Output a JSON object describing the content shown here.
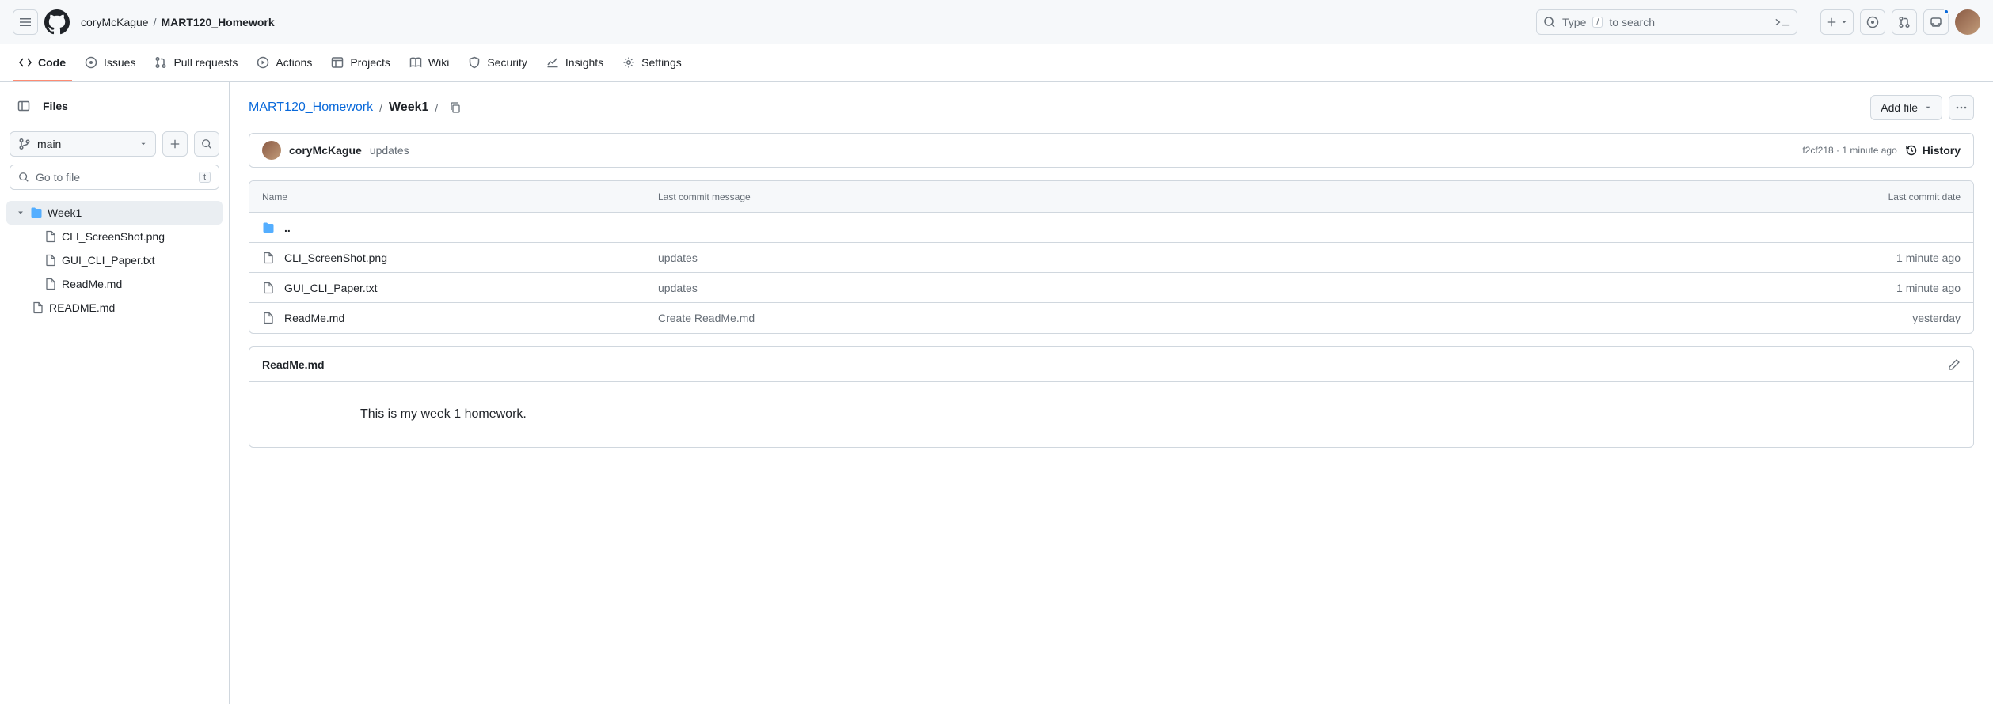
{
  "header": {
    "owner": "coryMcKague",
    "repo": "MART120_Homework",
    "search_prefix": "Type ",
    "search_key": "/",
    "search_suffix": " to search"
  },
  "nav": {
    "code": "Code",
    "issues": "Issues",
    "pulls": "Pull requests",
    "actions": "Actions",
    "projects": "Projects",
    "wiki": "Wiki",
    "security": "Security",
    "insights": "Insights",
    "settings": "Settings"
  },
  "sidebar": {
    "title": "Files",
    "branch": "main",
    "search_placeholder": "Go to file",
    "search_key": "t",
    "tree": {
      "folder": "Week1",
      "files": [
        "CLI_ScreenShot.png",
        "GUI_CLI_Paper.txt",
        "ReadMe.md"
      ],
      "root_file": "README.md"
    }
  },
  "path": {
    "repo": "MART120_Homework",
    "folder": "Week1",
    "addfile": "Add file"
  },
  "commit": {
    "user": "coryMcKague",
    "message": "updates",
    "sha": "f2cf218",
    "time": "1 minute ago",
    "history": "History"
  },
  "table": {
    "h_name": "Name",
    "h_msg": "Last commit message",
    "h_date": "Last commit date",
    "up": "..",
    "rows": [
      {
        "name": "CLI_ScreenShot.png",
        "msg": "updates",
        "date": "1 minute ago"
      },
      {
        "name": "GUI_CLI_Paper.txt",
        "msg": "updates",
        "date": "1 minute ago"
      },
      {
        "name": "ReadMe.md",
        "msg": "Create ReadMe.md",
        "date": "yesterday"
      }
    ]
  },
  "readme": {
    "name": "ReadMe.md",
    "body": "This is my week 1 homework."
  }
}
